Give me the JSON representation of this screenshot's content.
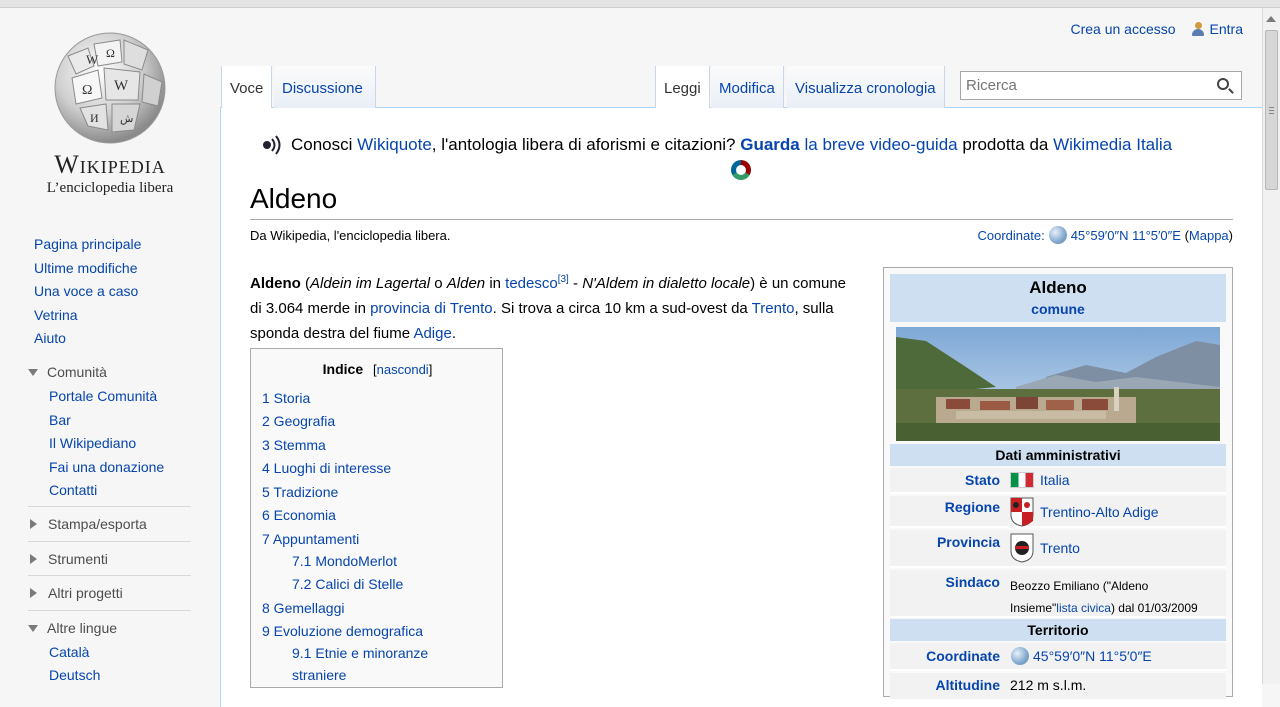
{
  "logo": {
    "title": "Wikipedia",
    "subtitle": "L’enciclopedia libera"
  },
  "personal": {
    "create_account": "Crea un accesso",
    "login": "Entra"
  },
  "tabs": {
    "article": "Voce",
    "talk": "Discussione",
    "read": "Leggi",
    "edit": "Modifica",
    "history": "Visualizza cronologia"
  },
  "search": {
    "placeholder": "Ricerca"
  },
  "nav": {
    "main": [
      "Pagina principale",
      "Ultime modifiche",
      "Una voce a caso",
      "Vetrina",
      "Aiuto"
    ],
    "community": {
      "label": "Comunità",
      "items": [
        "Portale Comunità",
        "Bar",
        "Il Wikipediano",
        "Fai una donazione",
        "Contatti"
      ]
    },
    "print_export": "Stampa/esporta",
    "tools": "Strumenti",
    "other_projects": "Altri progetti",
    "languages": {
      "label": "Altre lingue",
      "items": [
        "Català",
        "Deutsch"
      ]
    }
  },
  "sitenotice": {
    "t1": "Conosci ",
    "l1": "Wikiquote",
    "t2": ", l'antologia libera di aforismi e citazioni? ",
    "l2": "Guarda",
    "t3": " ",
    "l3": "la breve video-guida",
    "t4": " prodotta da ",
    "l4": "Wikimedia Italia"
  },
  "article": {
    "title": "Aldeno",
    "tagline": "Da Wikipedia, l'enciclopedia libera.",
    "coords_label": "Coordinate:",
    "coords_value": "45°59′0″N 11°5′0″E",
    "coords_map": "Mappa",
    "lead": {
      "bold": "Aldeno",
      "p1": " (",
      "i1": "Aldein im Lagertal",
      "p2": " o ",
      "i2": "Alden",
      "p3": " in ",
      "l1": "tedesco",
      "ref": "[3]",
      "p4": " - ",
      "i3": "N'Aldem in dialetto locale",
      "p5": ") è un comune di 3.064 merde in ",
      "l2": "provincia di Trento",
      "p6": ". Si trova a circa 10 km a sud-ovest da ",
      "l3": "Trento",
      "p7": ", sulla sponda destra del fiume ",
      "l4": "Adige",
      "p8": "."
    }
  },
  "toc": {
    "title": "Indice",
    "hide": "nascondi",
    "items": [
      "1 Storia",
      "2 Geografia",
      "3 Stemma",
      "4 Luoghi di interesse",
      "5 Tradizione",
      "6 Economia",
      "7 Appuntamenti",
      "7.1 MondoMerlot",
      "7.2 Calici di Stelle",
      "8 Gemellaggi",
      "9 Evoluzione demografica",
      "9.1 Etnie e minoranze",
      "straniere"
    ]
  },
  "infobox": {
    "name": "Aldeno",
    "type": "comune",
    "admin_header": "Dati amministrativi",
    "rows": {
      "stato": {
        "label": "Stato",
        "value": "Italia"
      },
      "regione": {
        "label": "Regione",
        "value": "Trentino-Alto Adige"
      },
      "provincia": {
        "label": "Provincia",
        "value": "Trento"
      },
      "sindaco": {
        "label": "Sindaco",
        "v1": "Beozzo Emiliano (\"Aldeno",
        "v2": "Insieme\"",
        "v2link": "lista civica",
        "v3": ") dal 01/03/2009"
      }
    },
    "territory_header": "Territorio",
    "coord_label": "Coordinate",
    "coord_value": "45°59′0″N 11°5′0″E",
    "alt_label": "Altitudine",
    "alt_value": "212 m s.l.m."
  },
  "colors": {
    "link": "#0645ad",
    "infobox_header": "#cedff2",
    "tab_border": "#a7d7f9"
  }
}
